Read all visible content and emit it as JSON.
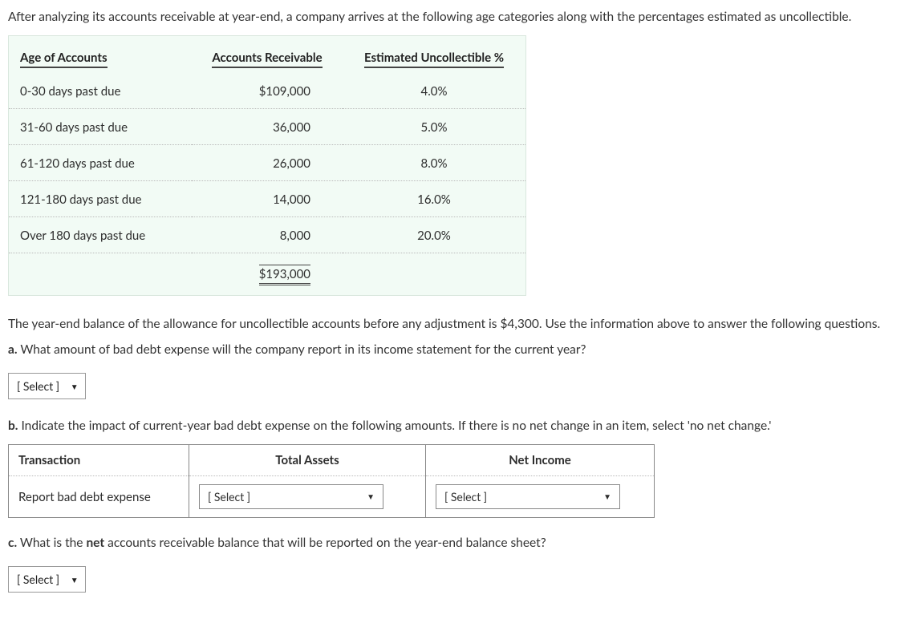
{
  "intro": "After analyzing its accounts receivable at year-end, a company arrives at the following age categories along with the percentages estimated as uncollectible.",
  "age_table": {
    "headers": {
      "age": "Age of Accounts",
      "ar": "Accounts Receivable",
      "pct": "Estimated Uncollectible %"
    },
    "rows": [
      {
        "age": "0-30 days past due",
        "ar": "$109,000",
        "pct": "4.0%"
      },
      {
        "age": "31-60 days past due",
        "ar": "36,000",
        "pct": "5.0%"
      },
      {
        "age": "61-120 days past due",
        "ar": "26,000",
        "pct": "8.0%"
      },
      {
        "age": "121-180 days past due",
        "ar": "14,000",
        "pct": "16.0%"
      },
      {
        "age": "Over 180 days past due",
        "ar": "8,000",
        "pct": "20.0%"
      }
    ],
    "total_ar": "$193,000"
  },
  "para2": "The year-end balance of the allowance for uncollectible accounts before any adjustment is $4,300. Use the information above to answer the following questions.",
  "qa": {
    "label": "a.",
    "text": " What amount of bad debt expense will the company report in its income statement for the current year?"
  },
  "qb": {
    "label": "b.",
    "text": " Indicate the impact of current-year bad debt expense on the following amounts. If there is no net change in an item, select 'no net change.'"
  },
  "qc": {
    "label": "c.",
    "text_pre": " What is the ",
    "text_bold": "net",
    "text_post": " accounts receivable balance that will be reported on the year-end balance sheet?"
  },
  "impact_table": {
    "headers": {
      "transaction": "Transaction",
      "assets": "Total Assets",
      "income": "Net Income"
    },
    "row_label": "Report bad debt expense"
  },
  "select_placeholder": "[ Select ]"
}
